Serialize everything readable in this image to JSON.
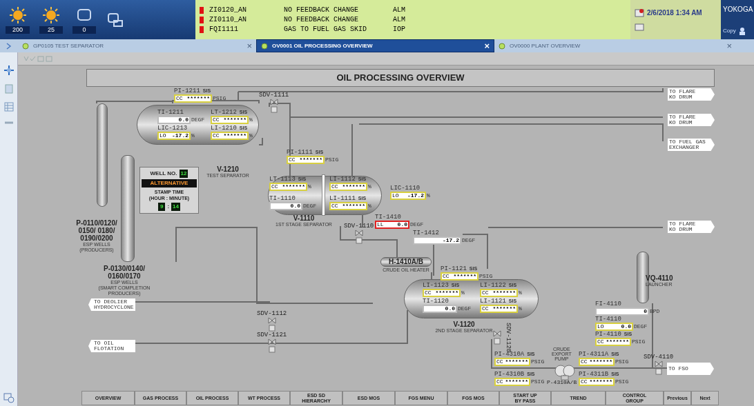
{
  "header": {
    "alarm_counters": [
      "200",
      "25",
      "0"
    ],
    "alarms": [
      {
        "tag": "ZI0120_AN",
        "message": "NO FEEDBACK CHANGE",
        "type": "ALM"
      },
      {
        "tag": "ZI0110_AN",
        "message": "NO FEEDBACK CHANGE",
        "type": "ALM"
      },
      {
        "tag": "FQI1111",
        "message": "GAS TO FUEL GAS SKID",
        "type": "IOP"
      }
    ],
    "datetime": "2/6/2018 1:34 AM",
    "brand": "YOKOGA",
    "copy_label": "Copy"
  },
  "tabs": [
    {
      "label": "GP0105 TEST SEPARATOR",
      "close": "×",
      "selected": false
    },
    {
      "label": "OV0001 OIL PROCESSING OVERVIEW",
      "close": "×",
      "selected": true
    },
    {
      "label": "OV0000 PLANT OVERVIEW",
      "close": "×",
      "selected": false
    }
  ],
  "page_title": "OIL PROCESSING OVERVIEW",
  "instruments": [
    {
      "tag": "PI-1211",
      "badge": "SIS",
      "prefix": "CC",
      "value": "*******",
      "unit": "PSIG",
      "kind": "alarm"
    },
    {
      "tag": "TI-1211",
      "value": "0.0",
      "unit": "DEGF",
      "kind": "normal"
    },
    {
      "tag": "LT-1212",
      "badge": "SIS",
      "prefix": "CC",
      "value": "*******",
      "unit": "%",
      "kind": "alarm"
    },
    {
      "tag": "LIC-1213",
      "prefix": "LO",
      "value": "-17.2",
      "unit": "%",
      "kind": "alarm"
    },
    {
      "tag": "LI-1210",
      "badge": "SIS",
      "prefix": "CC",
      "value": "*******",
      "unit": "%",
      "kind": "alarm"
    },
    {
      "tag": "PI-1111",
      "badge": "SIS",
      "prefix": "CC",
      "value": "*******",
      "unit": "PSIG",
      "kind": "alarm"
    },
    {
      "tag": "LT-1113",
      "badge": "SIS",
      "prefix": "CC",
      "value": "*******",
      "unit": "%",
      "kind": "alarm"
    },
    {
      "tag": "TI-1110",
      "value": "0.0",
      "unit": "DEGF",
      "kind": "normal"
    },
    {
      "tag": "LI-1112",
      "badge": "SIS",
      "prefix": "CC",
      "value": "*******",
      "unit": "%",
      "kind": "alarm"
    },
    {
      "tag": "LI-1111",
      "badge": "SIS",
      "prefix": "CC",
      "value": "*******",
      "unit": "%",
      "kind": "alarm"
    },
    {
      "tag": "LIC-1110",
      "prefix": "LO",
      "value": "-17.2",
      "unit": "%",
      "kind": "alarm"
    },
    {
      "tag": "TI-1410",
      "prefix": "LL",
      "value": "0.0",
      "unit": "DEGF",
      "kind": "trip"
    },
    {
      "tag": "TI-1412",
      "value": "-17.2",
      "unit": "DEGF",
      "kind": "normal"
    },
    {
      "tag": "PI-1121",
      "badge": "SIS",
      "prefix": "CC",
      "value": "*******",
      "unit": "PSIG",
      "kind": "alarm"
    },
    {
      "tag": "LI-1123",
      "badge": "SIS",
      "prefix": "CC",
      "value": "*******",
      "unit": "%",
      "kind": "alarm"
    },
    {
      "tag": "LI-1122",
      "badge": "SIS",
      "prefix": "CC",
      "value": "*******",
      "unit": "%",
      "kind": "alarm"
    },
    {
      "tag": "TI-1120",
      "value": "0.0",
      "unit": "DEGF",
      "kind": "normal"
    },
    {
      "tag": "LI-1121",
      "badge": "SIS",
      "prefix": "CC",
      "value": "*******",
      "unit": "%",
      "kind": "alarm"
    },
    {
      "tag": "FI-4110",
      "value": "0",
      "unit": "BPD",
      "kind": "normal"
    },
    {
      "tag": "TI-4110",
      "prefix": "LO",
      "value": "0.0",
      "unit": "DEGF",
      "kind": "alarm"
    },
    {
      "tag": "PI-4110",
      "badge": "SIS",
      "prefix": "CC",
      "value": "*******",
      "unit": "PSIG",
      "kind": "alarm"
    },
    {
      "tag": "PI-4310A",
      "badge": "SIS",
      "prefix": "CC",
      "value": "*******",
      "unit": "PSIG",
      "kind": "alarm"
    },
    {
      "tag": "PI-4310B",
      "badge": "SIS",
      "prefix": "CC",
      "value": "*******",
      "unit": "PSIG",
      "kind": "alarm"
    },
    {
      "tag": "PI-4311A",
      "badge": "SIS",
      "prefix": "CC",
      "value": "*******",
      "unit": "PSIG",
      "kind": "alarm"
    },
    {
      "tag": "PI-4311B",
      "badge": "SIS",
      "prefix": "CC",
      "value": "*******",
      "unit": "PSIG",
      "kind": "alarm"
    }
  ],
  "equipment": [
    {
      "name": "V-1210",
      "subtitle": "TEST SEPARATOR"
    },
    {
      "name": "V-1110",
      "subtitle": "1ST STAGE SEPARATOR"
    },
    {
      "name": "V-1120",
      "subtitle": "2ND STAGE SEPARATOR"
    },
    {
      "name": "H-1410A/B",
      "subtitle": "CRUDE OIL HEATER"
    },
    {
      "name": "VQ-4110",
      "subtitle": "LAUNCHER"
    },
    {
      "name": "P-0110/0120/\n0150/ 0180/\n0190/0200",
      "subtitle": "ESP WELLS\n(PRODUCERS)"
    },
    {
      "name": "P-0130/0140/\n0160/0170",
      "subtitle": "ESP WELLS\n(SMART COMPLETION\nPRODUCERS)"
    },
    {
      "name": "P-4310A/B",
      "subtitle": "CRUDE\nEXPORT\nPUMP"
    }
  ],
  "valves": [
    "SDV-1111",
    "SDV-1110",
    "SDV-1112",
    "SDV-1121",
    "SDV-1120",
    "SDV-4110"
  ],
  "connectors": [
    {
      "label": "TO FLARE\nKO DRUM",
      "kind": "right"
    },
    {
      "label": "TO FLARE\nKO DRUM",
      "kind": "right"
    },
    {
      "label": "TO FUEL GAS\nEXCHANGER",
      "kind": "right"
    },
    {
      "label": "TO FLARE\nKO DRUM",
      "kind": "right"
    },
    {
      "label": "TO FSO",
      "kind": "right"
    },
    {
      "label": "TO DEOLIER\nHYDROCYCLONE",
      "kind": "left"
    },
    {
      "label": "TO OIL\nFLOTATION",
      "kind": "left"
    }
  ],
  "well_panel": {
    "well_label": "WELL NO.",
    "well_no": "12",
    "mode": "ALTERNATIVE",
    "stamp_title": "STAMP TIME\n(HOUR : MINUTE)",
    "hour": "9",
    "separator": ":",
    "minute": "14"
  },
  "nav_buttons": [
    "OVERVIEW",
    "GAS PROCESS",
    "OIL PROCESS",
    "WT PROCESS",
    "ESD SD\nHIERARCHY",
    "ESD MOS",
    "FGS MENU",
    "FGS MOS",
    "START UP\nBY PASS",
    "TREND",
    "CONTROL\nGROUP",
    "Previous",
    "Next"
  ]
}
